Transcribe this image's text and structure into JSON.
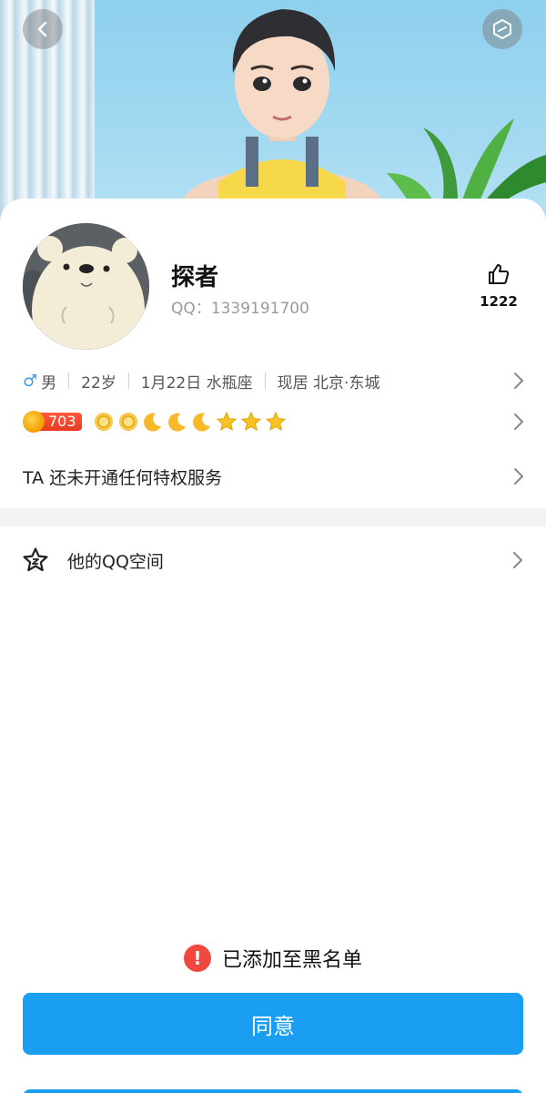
{
  "header": {
    "back_icon": "chevron-left-icon",
    "menu_icon": "hexagon-icon"
  },
  "profile": {
    "nickname": "探者",
    "qq_label": "QQ：",
    "qq_number": "1339191700",
    "like_icon": "thumbs-up-icon",
    "like_count": "1222"
  },
  "info": {
    "gender_symbol": "♂",
    "gender": "男",
    "age": "22岁",
    "birthday": "1月22日 水瓶座",
    "location": "现居 北京·东城"
  },
  "level": {
    "value": "703",
    "icons": [
      "sun",
      "sun",
      "moon",
      "moon",
      "moon",
      "star",
      "star",
      "star"
    ]
  },
  "privilege": {
    "text": "TA 还未开通任何特权服务"
  },
  "qzone": {
    "icon": "star-outline-icon",
    "label": "他的QQ空间"
  },
  "status": {
    "blacklist_text": "已添加至黑名单"
  },
  "actions": {
    "agree_label": "同意"
  },
  "colors": {
    "accent": "#1a9ef2",
    "warning": "#f0483e",
    "gender": "#3a9ae8"
  }
}
